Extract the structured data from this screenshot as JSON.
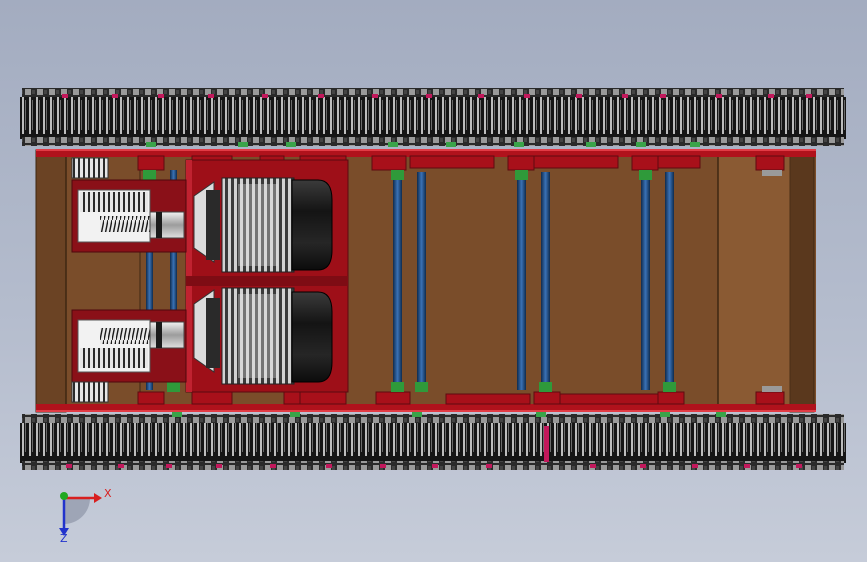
{
  "triad": {
    "x_label": "X",
    "z_label": "Z",
    "x_color": "#d81f1f",
    "y_color": "#21a821",
    "z_color": "#2233cc"
  },
  "colors": {
    "frame_brown": "#7a4d2a",
    "frame_dark": "#4c2f18",
    "chassis_red": "#b0121c",
    "track_black": "#161616",
    "rod_blue": "#1f4f8a",
    "rod_green": "#2f9a3a",
    "motor_black": "#1c1c1c",
    "gear_silver": "#b9b9b9"
  }
}
